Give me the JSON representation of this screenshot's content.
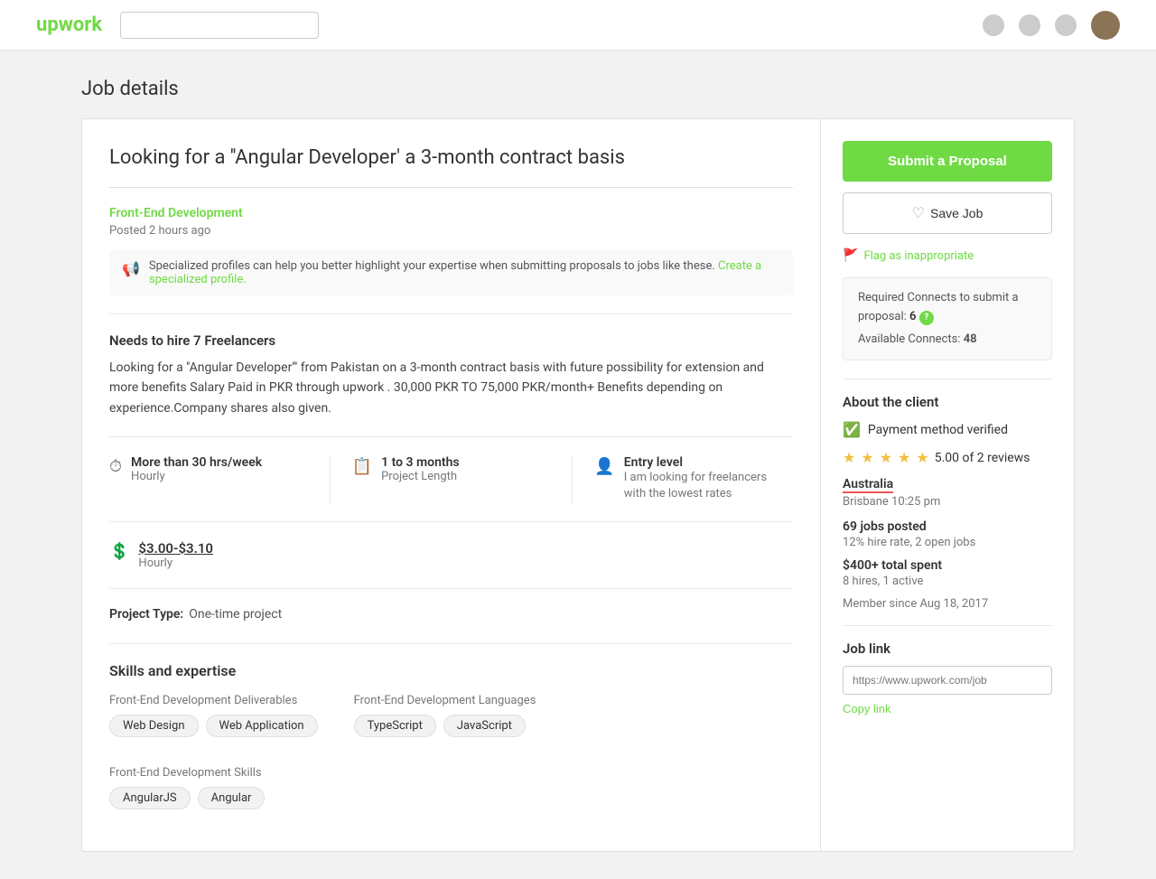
{
  "header": {
    "logo": "upwork",
    "search_placeholder": ""
  },
  "page": {
    "title": "Job details"
  },
  "job": {
    "title": "Looking for a ''Angular Developer' a 3-month contract basis",
    "category": "Front-End Development",
    "posted": "Posted 2 hours ago",
    "alert_text": "Specialized profiles can help you better highlight your expertise when submitting proposals to jobs like these.",
    "create_profile_link": "Create a specialized profile.",
    "needs_hire": "Needs to hire 7 Freelancers",
    "description": "Looking for a ''Angular Developer''' from Pakistan on a 3-month contract basis with future possibility for extension and more benefits Salary Paid in PKR through upwork . 30,000 PKR TO 75,000 PKR/month+ Benefits depending on experience.Company shares also given.",
    "stats": [
      {
        "icon": "⏱",
        "label": "More than 30 hrs/week",
        "sub": "Hourly"
      },
      {
        "icon": "📅",
        "label": "1 to 3 months",
        "sub": "Project Length"
      },
      {
        "icon": "👤",
        "label": "Entry level",
        "sub": "I am looking for freelancers with the lowest rates"
      }
    ],
    "hourly_rate": "$3.00-$3.10",
    "hourly_label": "Hourly",
    "project_type_label": "Project Type:",
    "project_type_value": "One-time project",
    "skills_title": "Skills and expertise",
    "skill_groups": [
      {
        "title": "Front-End Development Deliverables",
        "tags": [
          "Web Design",
          "Web Application"
        ]
      },
      {
        "title": "Front-End Development Languages",
        "tags": [
          "TypeScript",
          "JavaScript"
        ]
      },
      {
        "title": "Front-End Development Skills",
        "tags": [
          "AngularJS",
          "Angular"
        ]
      }
    ]
  },
  "sidebar": {
    "submit_label": "Submit a Proposal",
    "save_label": "Save Job",
    "flag_label": "Flag as inappropriate",
    "connects_label": "Required Connects to submit a proposal:",
    "connects_num": "6",
    "available_label": "Available Connects:",
    "available_num": "48",
    "client_section": "About the client",
    "payment_verified": "Payment method verified",
    "rating": "5.00 of 2 reviews",
    "location": "Australia",
    "city_time": "Brisbane 10:25 pm",
    "jobs_posted_label": "69 jobs posted",
    "jobs_posted_sub": "12% hire rate, 2 open jobs",
    "total_spent_label": "$400+ total spent",
    "total_spent_sub": "8 hires, 1 active",
    "member_since": "Member since Aug 18, 2017",
    "job_link_section": "Job link",
    "job_link_value": "https://www.upwork.com/job",
    "copy_link_label": "Copy link"
  }
}
